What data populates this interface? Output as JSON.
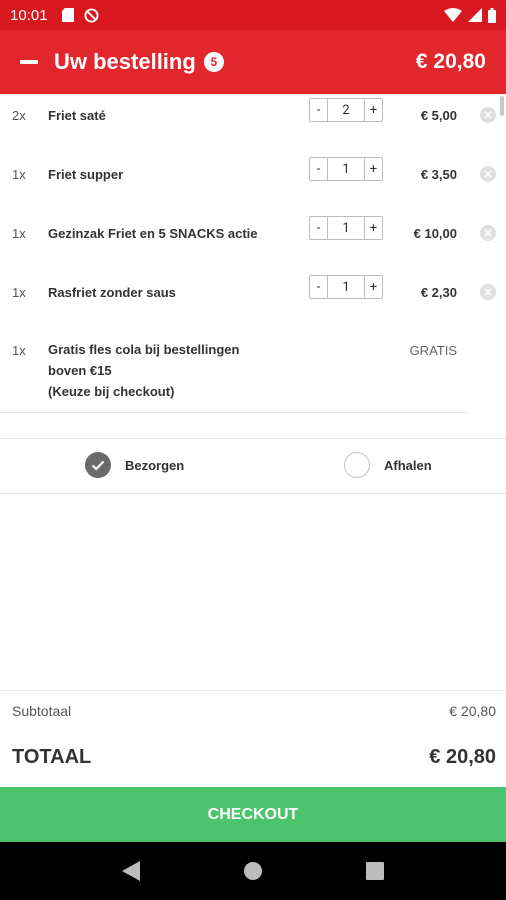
{
  "status_bar": {
    "time": "10:01"
  },
  "header": {
    "title": "Uw bestelling",
    "item_count": "5",
    "total": "€ 20,80"
  },
  "order_items": [
    {
      "qty_label": "2x",
      "name": "Friet saté",
      "qty_value": "2",
      "price": "€ 5,00"
    },
    {
      "qty_label": "1x",
      "name": "Friet supper",
      "qty_value": "1",
      "price": "€ 3,50"
    },
    {
      "qty_label": "1x",
      "name": "Gezinzak Friet en 5 SNACKS actie",
      "qty_value": "1",
      "price": "€ 10,00"
    },
    {
      "qty_label": "1x",
      "name": "Rasfriet zonder saus",
      "qty_value": "1",
      "price": "€ 2,30"
    }
  ],
  "free_item": {
    "qty_label": "1x",
    "name_line1": "Gratis fles cola bij bestellingen",
    "name_line2": "boven €15",
    "name_line3": "(Keuze bij checkout)",
    "price": "GRATIS"
  },
  "stepper": {
    "minus": "-",
    "plus": "+"
  },
  "delivery": {
    "option_delivery": "Bezorgen",
    "option_pickup": "Afhalen",
    "selected": "Bezorgen"
  },
  "summary": {
    "subtotal_label": "Subtotaal",
    "subtotal_value": "€ 20,80",
    "total_label": "TOTAAL",
    "total_value": "€ 20,80"
  },
  "checkout": {
    "label": "CHECKOUT"
  },
  "colors": {
    "status_bar": "#d7191f",
    "header": "#e1262c",
    "checkout": "#4cc46e",
    "radio_checked": "#6a6a6a"
  },
  "icons": [
    "sd-card-icon",
    "no-disturb-icon",
    "wifi-icon",
    "signal-icon",
    "battery-icon",
    "remove-icon",
    "check-icon",
    "back-icon",
    "home-icon",
    "recents-icon"
  ]
}
